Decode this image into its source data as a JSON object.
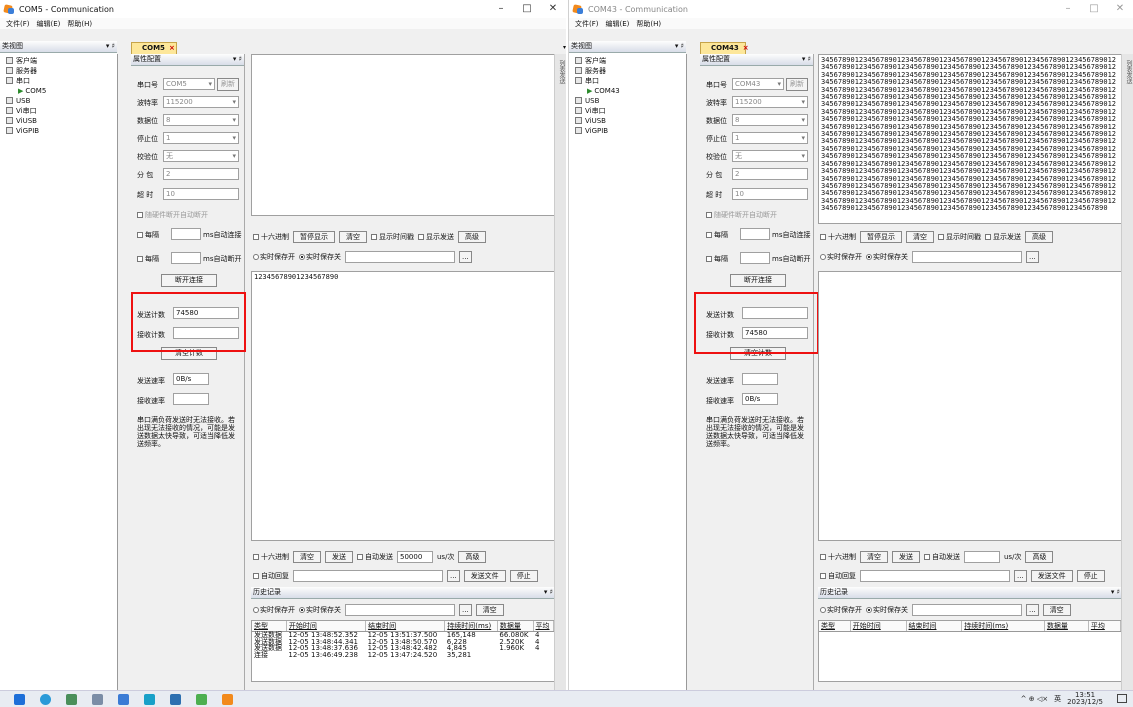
{
  "colors": {
    "accent_red": "#e11111",
    "tab_yellow": "#fde79a",
    "taskbar": "#e8ecf2"
  },
  "menu": {
    "file": "文件(F)",
    "edit": "编辑(E)",
    "help": "帮助(H)"
  },
  "view_pane": {
    "title": "类视图",
    "pin": "▾ ♯"
  },
  "tree": [
    "客户端",
    "服务器",
    "串口",
    "USB",
    "Vi串口",
    "ViUSB",
    "ViGPIB"
  ],
  "props_title": "属性配置",
  "labels": {
    "port": "串口号",
    "baud": "波特率",
    "databits": "数据位",
    "stopbits": "停止位",
    "parity": "校验位",
    "split": "分 包",
    "timeout": "超 时",
    "autodisc": "随硬件断开自动断开",
    "every": "每隔",
    "ms_connect": "ms自动连接",
    "ms_disconnect": "ms自动断开",
    "disconnect_btn": "断开连接",
    "send_count": "发送计数",
    "recv_count": "接收计数",
    "clear_count": "清空计数",
    "send_rate": "发送速率",
    "recv_rate": "接收速率",
    "note": "串口满负荷发送时无法接收。若出现无法接收的情况，可能是发送数据太快导致，可适当降低发送频率。",
    "refresh": "刷新"
  },
  "values": {
    "baud": "115200",
    "databits": "8",
    "stopbits": "1",
    "parity": "无",
    "split": "2",
    "timeout": "10"
  },
  "recv_toolbar": {
    "hex": "十六进制",
    "pause": "暂停显示",
    "clear": "清空",
    "show_time": "显示时间戳",
    "show_send": "显示发送",
    "advanced": "高级",
    "realtime_on": "实时保存开",
    "realtime_off": "实时保存关",
    "browse": "..."
  },
  "send_toolbar": {
    "hex": "十六进制",
    "clear": "清空",
    "send": "发送",
    "auto_send": "自动发送",
    "unit": "us/次",
    "advanced": "高级",
    "auto_reply": "自动回复",
    "send_file": "发送文件",
    "stop": "停止"
  },
  "history": {
    "title": "历史记录",
    "realtime_on": "实时保存开",
    "realtime_off": "实时保存关",
    "clear": "清空",
    "browse": "...",
    "columns": [
      "类型",
      "开始时间",
      "结束时间",
      "持续时间(ms)",
      "数据量",
      "平均"
    ],
    "rows": [
      [
        "发送数据",
        "12-05 13:48:52.352",
        "12-05 13:51:37.500",
        "165,148",
        "66.080K",
        "4"
      ],
      [
        "发送数据",
        "12-05 13:48:44.341",
        "12-05 13:48:50.570",
        "6,228",
        "2.520K",
        "4"
      ],
      [
        "发送数据",
        "12-05 13:48:37.636",
        "12-05 13:48:42.482",
        "4,845",
        "1.960K",
        "4"
      ],
      [
        "连接",
        "12-05 13:46:49.238",
        "12-05 13:47:24.520",
        "35,281",
        "",
        ""
      ]
    ]
  },
  "side_label": "列表发送",
  "win1": {
    "title": "COM5 - Communication",
    "tab": "COM5",
    "port": "COM5",
    "tree_port": "COM5",
    "send_count": "74580",
    "recv_count": "",
    "send_rate": "0B/s",
    "recv_rate": "",
    "recv_text": "",
    "send_text": "12345678901234567890",
    "auto_ms": "50000"
  },
  "win2": {
    "title": "COM43 - Communication",
    "tab": "COM43",
    "port": "COM43",
    "tree_port": "COM43",
    "send_count": "",
    "recv_count": "74580",
    "send_rate": "",
    "recv_rate": "0B/s",
    "auto_ms": "",
    "recv_lines": [
      "3456789012345678901234567890123456789012345678901234567890123456789012",
      "3456789012345678901234567890123456789012345678901234567890123456789012",
      "3456789012345678901234567890123456789012345678901234567890123456789012",
      "3456789012345678901234567890123456789012345678901234567890123456789012",
      "3456789012345678901234567890123456789012345678901234567890123456789012",
      "3456789012345678901234567890123456789012345678901234567890123456789012",
      "3456789012345678901234567890123456789012345678901234567890123456789012",
      "3456789012345678901234567890123456789012345678901234567890123456789012",
      "3456789012345678901234567890123456789012345678901234567890123456789012",
      "3456789012345678901234567890123456789012345678901234567890123456789012",
      "3456789012345678901234567890123456789012345678901234567890123456789012",
      "3456789012345678901234567890123456789012345678901234567890123456789012",
      "3456789012345678901234567890123456789012345678901234567890123456789012",
      "3456789012345678901234567890123456789012345678901234567890123456789012",
      "3456789012345678901234567890123456789012345678901234567890123456789012",
      "3456789012345678901234567890123456789012345678901234567890123456789012",
      "3456789012345678901234567890123456789012345678901234567890123456789012",
      "3456789012345678901234567890123456789012345678901234567890123456789012",
      "3456789012345678901234567890123456789012345678901234567890123456789012",
      "3456789012345678901234567890123456789012345678901234567890123456789012",
      "34567890123456789012345678901234567890123456789012345678901234567890"
    ]
  },
  "taskbar": {
    "tray_icons": "^ ⊕ ◁×",
    "lang": "英",
    "time": "13:51",
    "date": "2023/12/5"
  }
}
